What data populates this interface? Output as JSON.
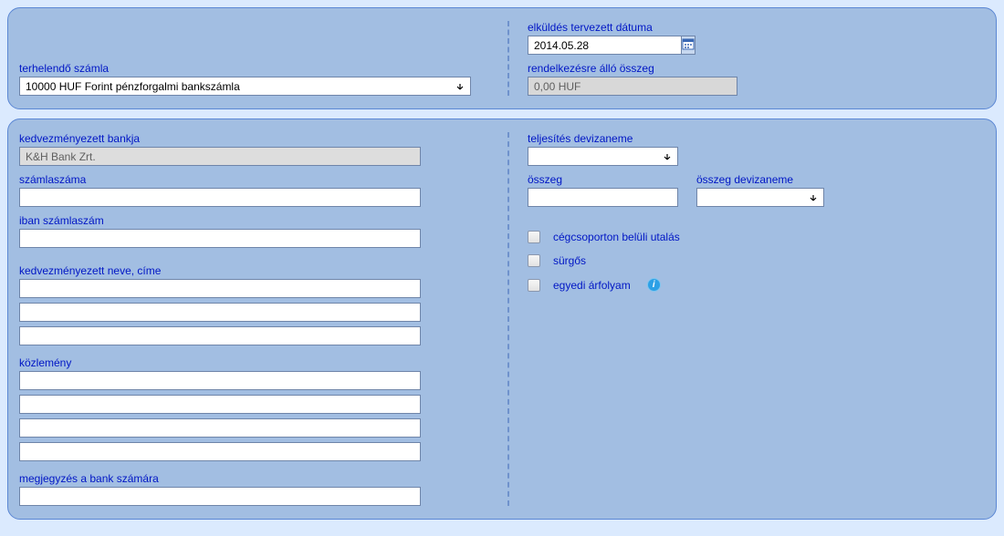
{
  "panel1": {
    "debitAccountLabel": "terhelendő számla",
    "debitAccountValue": "10000 HUF Forint pénzforgalmi bankszámla",
    "plannedDateLabel": "elküldés tervezett dátuma",
    "plannedDateValue": "2014.05.28",
    "availableLabel": "rendelkezésre álló összeg",
    "availableValue": "0,00 HUF"
  },
  "panel2": {
    "beneficiaryBankLabel": "kedvezményezett bankja",
    "beneficiaryBankValue": "K&H Bank Zrt.",
    "accountNumberLabel": "számlaszáma",
    "ibanLabel": "iban számlaszám",
    "beneficiaryNameLabel": "kedvezményezett neve, címe",
    "nameLines": [
      "",
      "",
      ""
    ],
    "statementLabel": "közlemény",
    "statementLines": [
      "",
      "",
      "",
      ""
    ],
    "bankNoteLabel": "megjegyzés a bank számára",
    "settlementCurrencyLabel": "teljesítés devizaneme",
    "amountLabel": "összeg",
    "amountCurrencyLabel": "összeg devizaneme",
    "check1": "cégcsoporton belüli utalás",
    "check2": "sürgős",
    "check3": "egyedi árfolyam"
  }
}
